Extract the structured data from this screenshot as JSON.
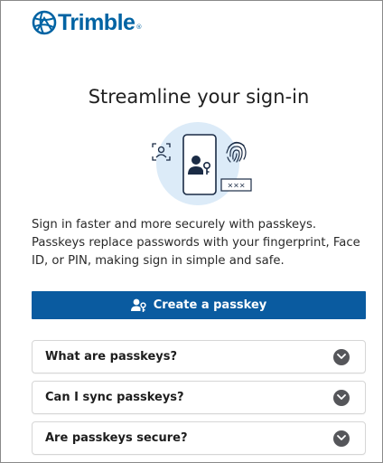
{
  "brand": {
    "name": "Trimble",
    "registered_mark": "®",
    "color": "#0063a3",
    "logo_icon": "trimble-globe-icon"
  },
  "main": {
    "title": "Streamline your sign-in",
    "illustration_icons": [
      "face-scan-icon",
      "phone-user-key-icon",
      "fingerprint-icon",
      "pin-entry-icon"
    ],
    "description": "Sign in faster and more securely with passkeys. Passkeys replace passwords with your fingerprint, Face ID, or PIN, making sign in simple and safe.",
    "create_button": {
      "label": "Create a passkey",
      "icon": "user-key-icon",
      "color": "#0a5ba0"
    }
  },
  "faq": [
    {
      "label": "What are passkeys?",
      "icon": "chevron-down-icon"
    },
    {
      "label": "Can I sync passkeys?",
      "icon": "chevron-down-icon"
    },
    {
      "label": "Are passkeys secure?",
      "icon": "chevron-down-icon"
    }
  ]
}
